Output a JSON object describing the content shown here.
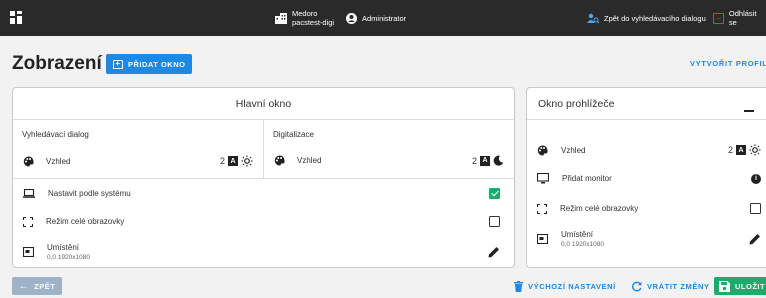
{
  "topbar": {
    "facility_line1": "Medoro",
    "facility_line2": "pacstest-digi",
    "user": "Administrator",
    "back_to_search": "Zpět do vyhledávacího dialogu",
    "logout": "Odhlásit se"
  },
  "page": {
    "title": "Zobrazení",
    "add_window": "PŘIDAT OKNO",
    "create_profile": "VYTVOŘIT PROFIL"
  },
  "main_window": {
    "title": "Hlavní okno",
    "search_dialog": {
      "title": "Vyhledávací dialog",
      "appearance_label": "Vzhled",
      "monitor": "2",
      "monitor_letter": "A",
      "theme": "light"
    },
    "digitization": {
      "title": "Digitalizace",
      "appearance_label": "Vzhled",
      "monitor": "2",
      "monitor_letter": "A",
      "theme": "dark"
    },
    "system_setting": {
      "label": "Nastavit podle systému",
      "checked": true
    },
    "fullscreen": {
      "label": "Režim celé obrazovky",
      "checked": false
    },
    "location": {
      "label": "Umístění",
      "value": "0,0 1920x1080"
    }
  },
  "viewer_window": {
    "title": "Okno prohlížeče",
    "appearance_label": "Vzhled",
    "monitor": "2",
    "monitor_letter": "A",
    "theme": "light",
    "add_monitor": "Přidat monitor",
    "fullscreen": {
      "label": "Režim celé obrazovky",
      "checked": false
    },
    "location": {
      "label": "Umístění",
      "value": "0,0 1920x1080"
    }
  },
  "footer": {
    "back": "ZPĚT",
    "default_settings": "VÝCHOZÍ NASTAVENÍ",
    "revert_changes": "VRÁTIT ZMĚNY",
    "save": "ULOŽIT"
  },
  "colors": {
    "accent": "#1e88e5",
    "success": "#1bab6b",
    "topbar": "#2a2a2a",
    "danger": "#e53935"
  }
}
